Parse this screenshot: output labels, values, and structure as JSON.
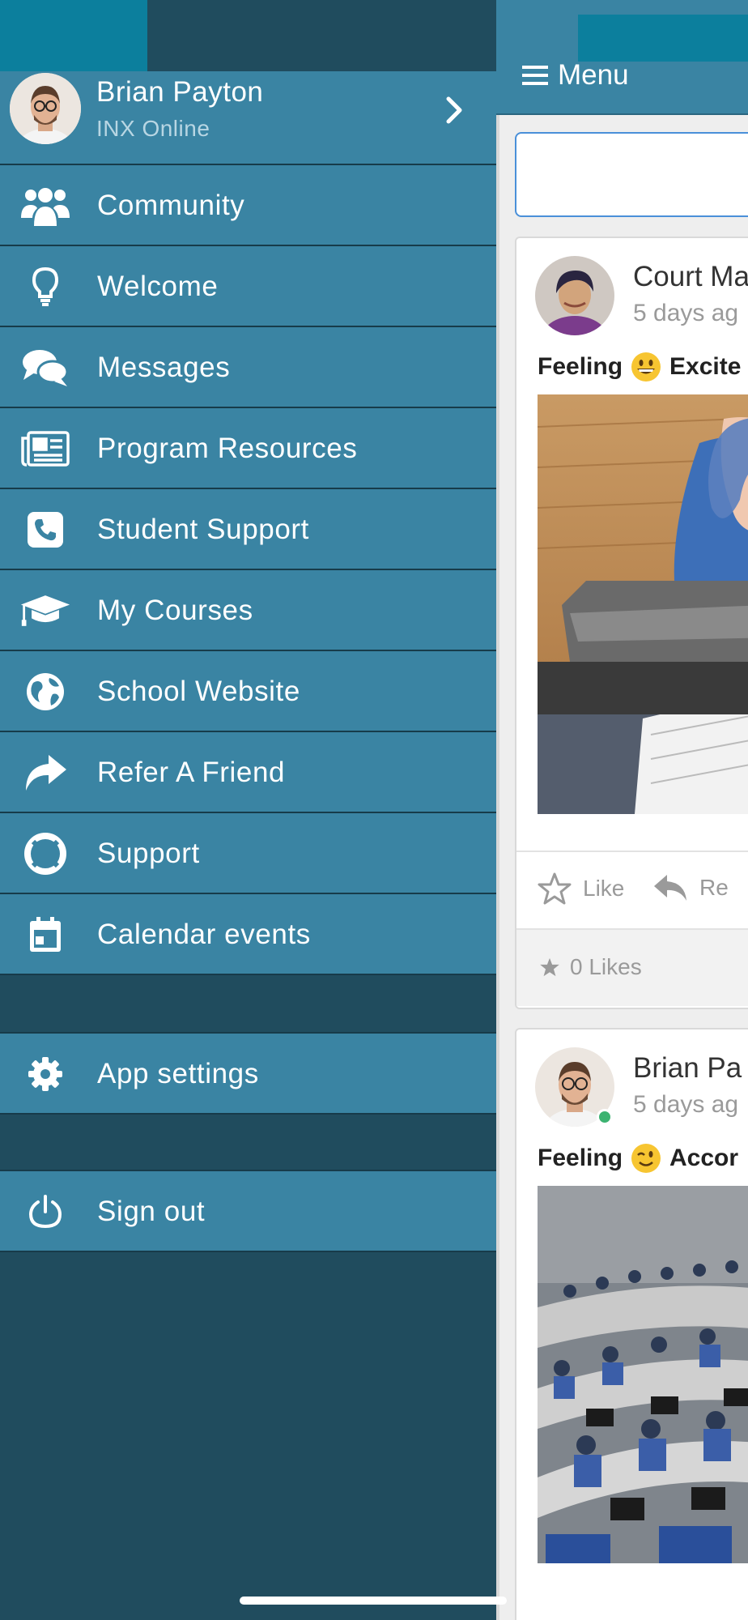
{
  "profile": {
    "name": "Brian Payton",
    "subtitle": "INX Online"
  },
  "menu": [
    {
      "label": "Community",
      "icon": "users-icon"
    },
    {
      "label": "Welcome",
      "icon": "lightbulb-icon"
    },
    {
      "label": "Messages",
      "icon": "chat-bubbles-icon"
    },
    {
      "label": "Program Resources",
      "icon": "newspaper-icon"
    },
    {
      "label": "Student Support",
      "icon": "phone-icon"
    },
    {
      "label": "My Courses",
      "icon": "graduation-cap-icon"
    },
    {
      "label": "School Website",
      "icon": "globe-icon"
    },
    {
      "label": "Refer A Friend",
      "icon": "share-arrow-icon"
    },
    {
      "label": "Support",
      "icon": "lifebuoy-icon"
    },
    {
      "label": "Calendar events",
      "icon": "calendar-icon"
    }
  ],
  "settings": {
    "label": "App settings",
    "icon": "gear-icon"
  },
  "signout": {
    "label": "Sign out",
    "icon": "power-icon"
  },
  "topbar": {
    "menu_label": "Menu"
  },
  "posts": [
    {
      "author": "Court Ma",
      "time": "5 days ag",
      "feeling_prefix": "Feeling",
      "feeling": "Excite",
      "actions": {
        "like": "Like",
        "reply": "Re"
      },
      "likes": "0 Likes"
    },
    {
      "author": "Brian Pa",
      "time": "5 days ag",
      "feeling_prefix": "Feeling",
      "feeling": "Accor"
    }
  ],
  "colors": {
    "drawer_item": "#3a84a3",
    "drawer_bg": "#204c5e",
    "accent_block": "#0c7f9d",
    "composer_border": "#4a90d9",
    "online": "#3cb371"
  }
}
